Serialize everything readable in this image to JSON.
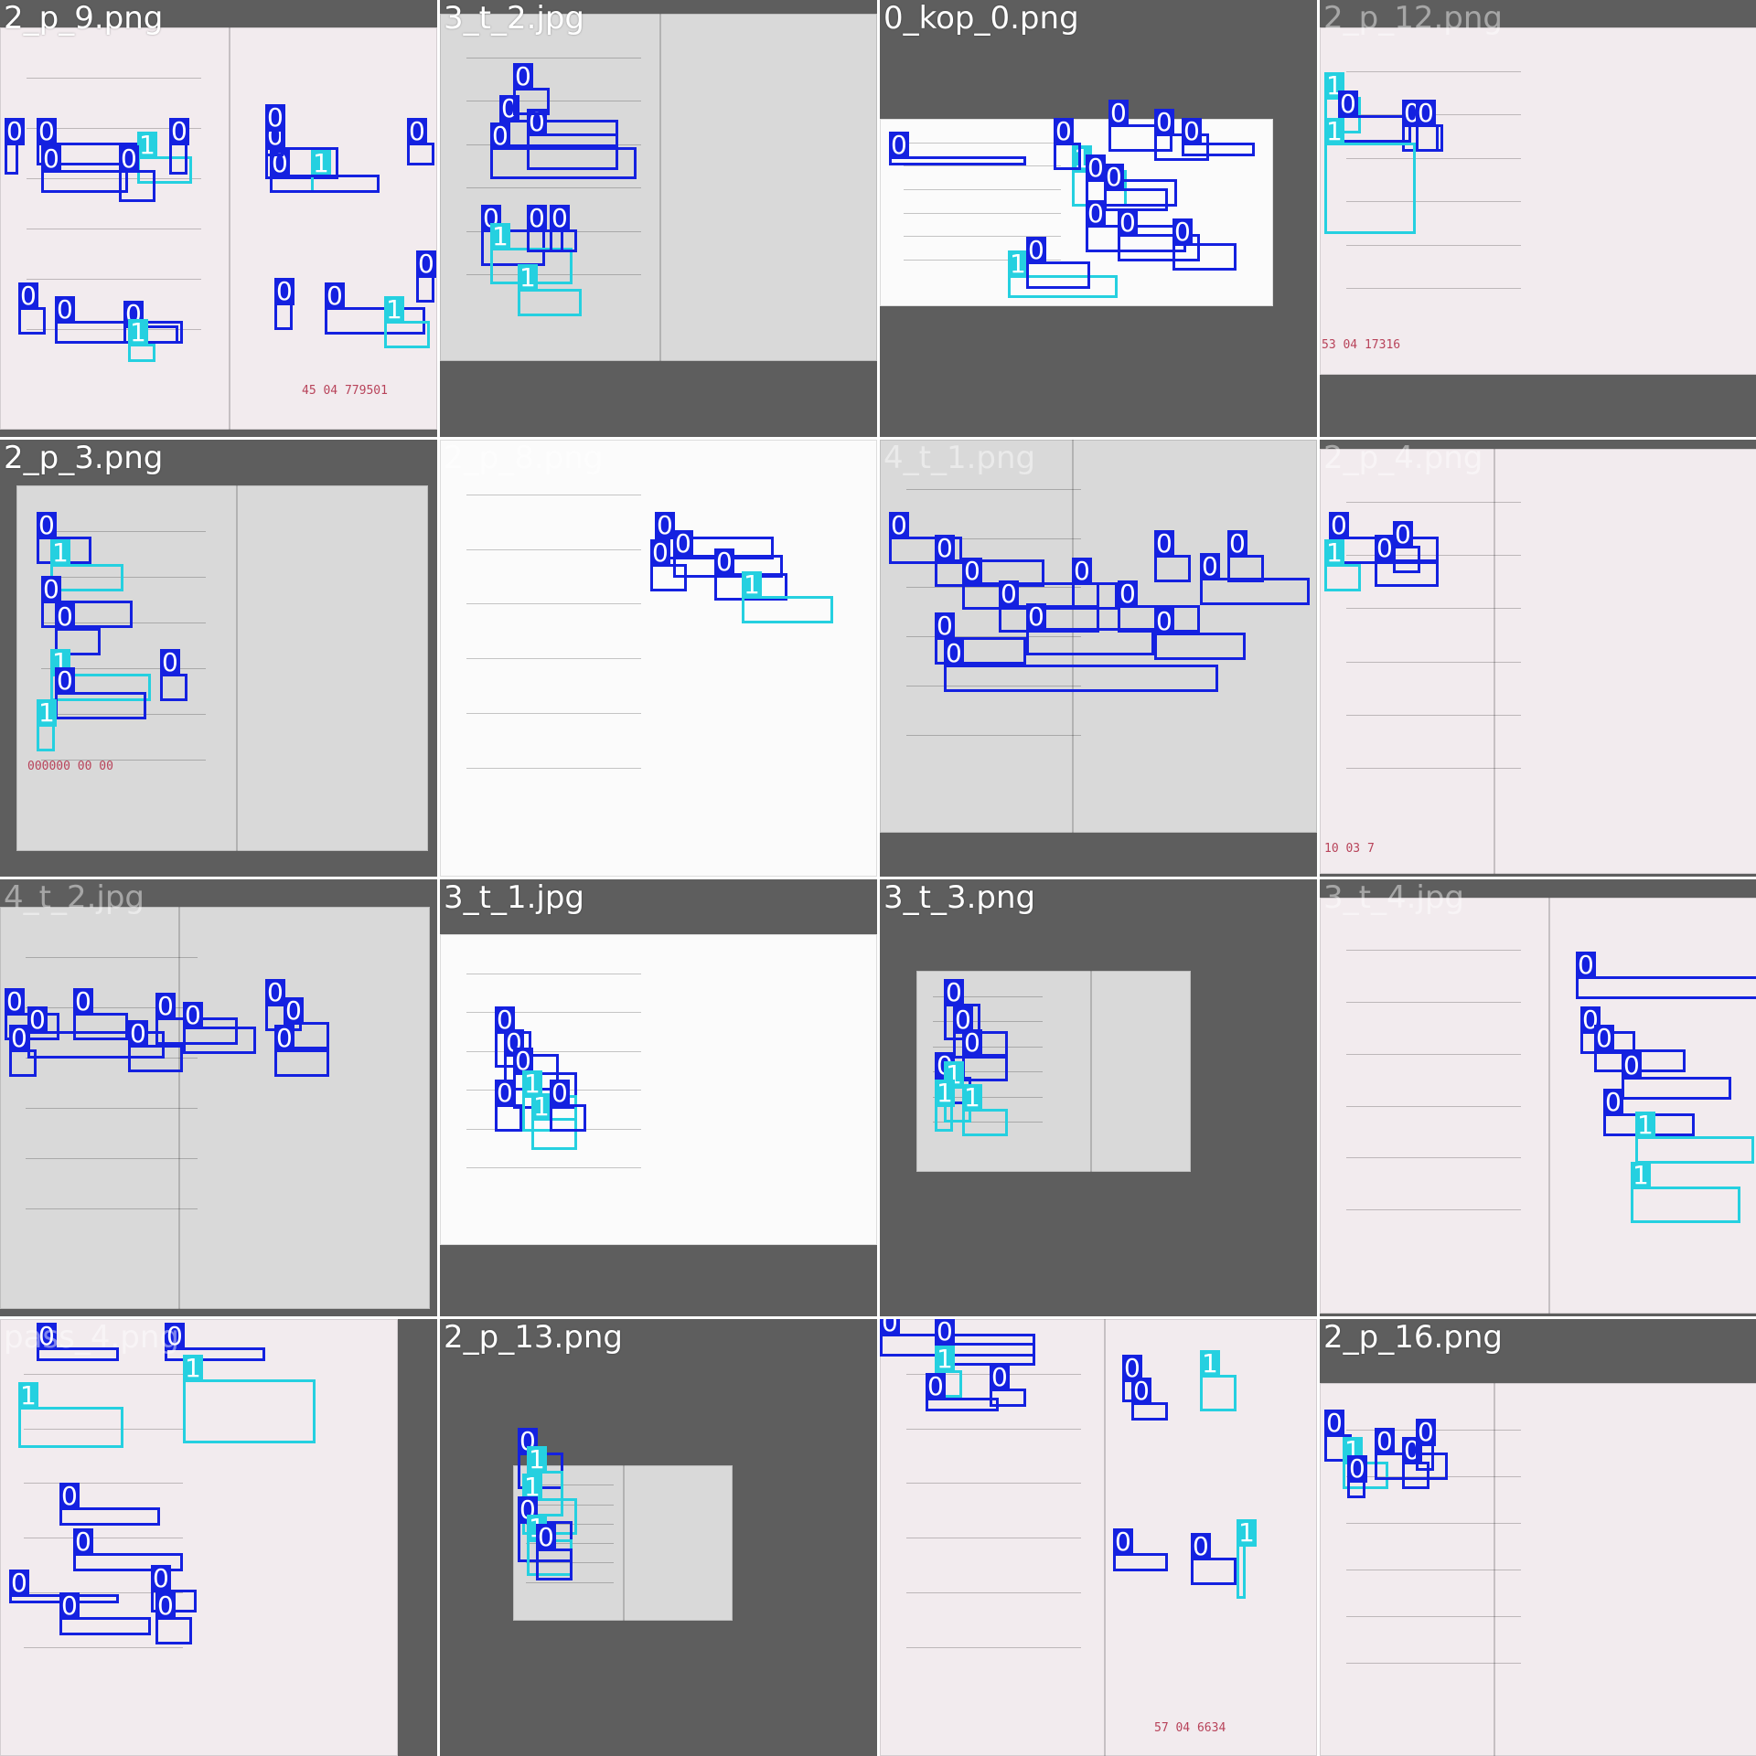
{
  "colors": {
    "class_0": "#1421e0",
    "class_1": "#25d0e0",
    "tile_background": "#5e5e5e"
  },
  "class_labels": [
    "0",
    "1"
  ],
  "tiles": [
    {
      "name": "2_p_9.png",
      "faint": false,
      "serial": "45  04  779501"
    },
    {
      "name": "3_t_2.jpg",
      "faint": false,
      "serial": ""
    },
    {
      "name": "0_kop_0.png",
      "faint": false,
      "serial": ""
    },
    {
      "name": "2_p_12.png",
      "faint": true,
      "serial": "53  04  17316"
    },
    {
      "name": "2_p_3.png",
      "faint": false,
      "serial": "000000  00  00"
    },
    {
      "name": "2_p_8.png",
      "faint": true,
      "serial": ""
    },
    {
      "name": "4_t_1.png",
      "faint": true,
      "serial": ""
    },
    {
      "name": "2_p_4.png",
      "faint": true,
      "serial": "10  03  7"
    },
    {
      "name": "4_t_2.jpg",
      "faint": true,
      "serial": ""
    },
    {
      "name": "3_t_1.jpg",
      "faint": false,
      "serial": ""
    },
    {
      "name": "3_t_3.png",
      "faint": false,
      "serial": ""
    },
    {
      "name": "3_t_4.jpg",
      "faint": true,
      "serial": ""
    },
    {
      "name": "pass_4.png",
      "faint": true,
      "serial": ""
    },
    {
      "name": "2_p_13.png",
      "faint": false,
      "serial": ""
    },
    {
      "name": "",
      "faint": false,
      "serial": "57  04  6634"
    },
    {
      "name": "2_p_16.png",
      "faint": false,
      "serial": ""
    }
  ]
}
